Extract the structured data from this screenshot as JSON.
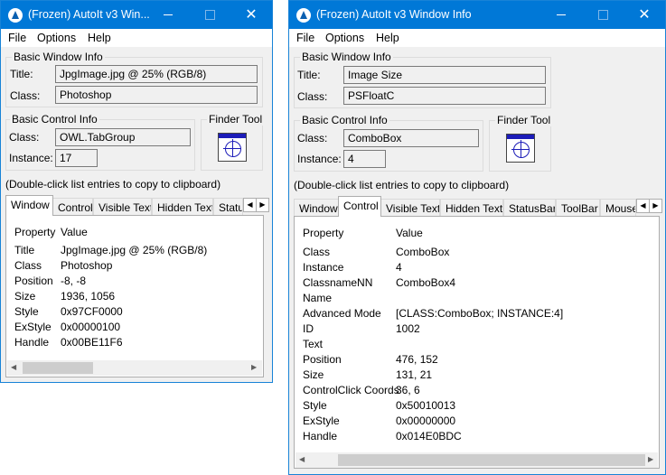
{
  "colors": {
    "titlebar": "#0078d7",
    "window_bg": "#f0f0f0",
    "finder_blue": "#1c1cb8"
  },
  "menu": [
    "File",
    "Options",
    "Help"
  ],
  "icons": {
    "app": "autoit-logo-icon",
    "finder": "finder-crosshair-icon",
    "minimize": "minimize-icon",
    "maximize": "maximize-icon",
    "close": "close-icon",
    "left": "scroll-left-icon",
    "right": "scroll-right-icon"
  },
  "left_window": {
    "title": "(Frozen) AutoIt v3 Win...",
    "basic_window_info": {
      "label": "Basic Window Info",
      "title_label": "Title:",
      "title_value": "JpgImage.jpg @ 25% (RGB/8)",
      "class_label": "Class:",
      "class_value": "Photoshop"
    },
    "basic_control_info": {
      "label": "Basic Control Info",
      "class_label": "Class:",
      "class_value": "OWL.TabGroup",
      "instance_label": "Instance:",
      "instance_value": "17"
    },
    "finder_tool": "Finder Tool",
    "hint": "(Double-click list entries to copy to clipboard)",
    "tabs": [
      "Window",
      "Control",
      "Visible Text",
      "Hidden Text",
      "Statu"
    ],
    "active_tab": "Window",
    "list_header": {
      "property": "Property",
      "value": "Value"
    },
    "rows": [
      {
        "property": "Title",
        "value": "JpgImage.jpg @ 25% (RGB/8)"
      },
      {
        "property": "Class",
        "value": "Photoshop"
      },
      {
        "property": "Position",
        "value": "-8, -8"
      },
      {
        "property": "Size",
        "value": "1936, 1056"
      },
      {
        "property": "Style",
        "value": "0x97CF0000"
      },
      {
        "property": "ExStyle",
        "value": "0x00000100"
      },
      {
        "property": "Handle",
        "value": "0x00BE11F6"
      }
    ]
  },
  "right_window": {
    "title": "(Frozen) AutoIt v3 Window Info",
    "basic_window_info": {
      "label": "Basic Window Info",
      "title_label": "Title:",
      "title_value": "Image Size",
      "class_label": "Class:",
      "class_value": "PSFloatC"
    },
    "basic_control_info": {
      "label": "Basic Control Info",
      "class_label": "Class:",
      "class_value": "ComboBox",
      "instance_label": "Instance:",
      "instance_value": "4"
    },
    "finder_tool": "Finder Tool",
    "hint": "(Double-click list entries to copy to clipboard)",
    "tabs": [
      "Window",
      "Control",
      "Visible Text",
      "Hidden Text",
      "StatusBar",
      "ToolBar",
      "Mouse"
    ],
    "active_tab": "Control",
    "list_header": {
      "property": "Property",
      "value": "Value"
    },
    "rows": [
      {
        "property": "Class",
        "value": "ComboBox"
      },
      {
        "property": "Instance",
        "value": "4"
      },
      {
        "property": "ClassnameNN",
        "value": "ComboBox4"
      },
      {
        "property": "Name",
        "value": ""
      },
      {
        "property": "Advanced Mode",
        "value": "[CLASS:ComboBox; INSTANCE:4]"
      },
      {
        "property": "ID",
        "value": "1002"
      },
      {
        "property": "Text",
        "value": ""
      },
      {
        "property": "Position",
        "value": "476, 152"
      },
      {
        "property": "Size",
        "value": "131, 21"
      },
      {
        "property": "ControlClick Coords",
        "value": "36, 6"
      },
      {
        "property": "Style",
        "value": "0x50010013"
      },
      {
        "property": "ExStyle",
        "value": "0x00000000"
      },
      {
        "property": "Handle",
        "value": "0x014E0BDC"
      }
    ]
  }
}
